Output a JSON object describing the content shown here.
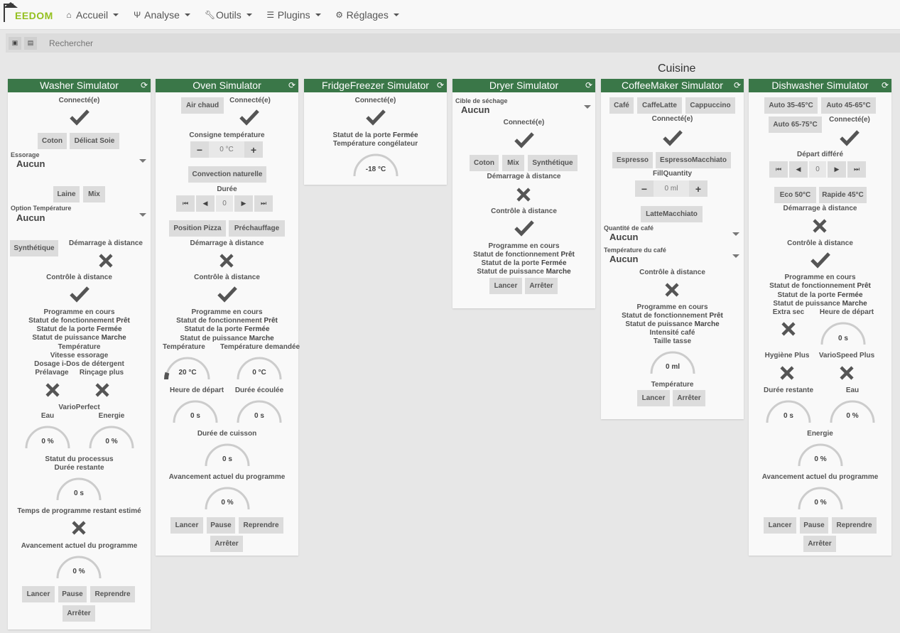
{
  "app": {
    "logo_text": "EEDOM"
  },
  "nav": {
    "accueil": "Accueil",
    "analyse": "Analyse",
    "outils": "Outils",
    "plugins": "Plugins",
    "reglages": "Réglages"
  },
  "search": {
    "placeholder": "Rechercher"
  },
  "room": {
    "title": "Cuisine"
  },
  "icons": {
    "check": "check-icon",
    "cross": "cross-icon",
    "refresh": "refresh-icon"
  },
  "colors": {
    "header": "#3a7748",
    "button": "#dcdcdc",
    "logo": "#94c01f"
  },
  "washer": {
    "title": "Washer Simulator",
    "connected": "Connecté(e)",
    "btn_coton": "Coton",
    "btn_delicat": "Délicat Soie",
    "essorage_label": "Essorage",
    "essorage_value": "Aucun",
    "btn_laine": "Laine",
    "btn_mix": "Mix",
    "option_temp_label": "Option Température",
    "option_temp_value": "Aucun",
    "btn_synthetique": "Synthétique",
    "demarrage": "Démarrage à distance",
    "controle": "Contrôle à distance",
    "programme": "Programme en cours",
    "statut_fonct_label": "Statut de fonctionnement",
    "statut_fonct_value": "Prêt",
    "statut_porte_label": "Statut de la porte",
    "statut_porte_value": "Fermée",
    "statut_puis_label": "Statut de puissance",
    "statut_puis_value": "Marche",
    "temperature": "Température",
    "vitesse": "Vitesse essorage",
    "dosage": "Dosage i-Dos de détergent",
    "prelavage": "Prélavage",
    "rincage": "Rinçage plus",
    "vario": "VarioPerfect",
    "eau": "Eau",
    "eau_val": "0 %",
    "energie": "Energie",
    "energie_val": "0 %",
    "statut_proc": "Statut du processus",
    "duree_restante": "Durée restante",
    "duree_restante_val": "0 s",
    "temps_estime": "Temps de programme restant estimé",
    "avancement": "Avancement actuel du programme",
    "avancement_val": "0 %",
    "btn_lancer": "Lancer",
    "btn_pause": "Pause",
    "btn_reprendre": "Reprendre",
    "btn_arreter": "Arrêter"
  },
  "oven": {
    "title": "Oven Simulator",
    "btn_air": "Air chaud",
    "connected": "Connecté(e)",
    "consigne": "Consigne température",
    "consigne_val": "0 °C",
    "btn_convection": "Convection naturelle",
    "duree": "Durée",
    "duree_val": "0",
    "btn_pizza": "Position Pizza",
    "btn_prechauffage": "Préchauffage",
    "demarrage": "Démarrage à distance",
    "controle": "Contrôle à distance",
    "programme": "Programme en cours",
    "statut_fonct_label": "Statut de fonctionnement",
    "statut_fonct_value": "Prêt",
    "statut_porte_label": "Statut de la porte",
    "statut_porte_value": "Fermée",
    "statut_puis_label": "Statut de puissance",
    "statut_puis_value": "Marche",
    "temperature": "Température",
    "temperature_val": "20 °C",
    "temperature_level": 0.1,
    "temp_demandee": "Température demandée",
    "temp_demandee_val": "0 °C",
    "heure_depart": "Heure de départ",
    "heure_depart_val": "0 s",
    "duree_ecoulee": "Durée écoulée",
    "duree_ecoulee_val": "0 s",
    "duree_cuisson": "Durée de cuisson",
    "duree_cuisson_val": "0 s",
    "avancement": "Avancement actuel du programme",
    "avancement_val": "0 %",
    "btn_lancer": "Lancer",
    "btn_pause": "Pause",
    "btn_reprendre": "Reprendre",
    "btn_arreter": "Arrêter"
  },
  "fridge": {
    "title": "FridgeFreezer Simulator",
    "connected": "Connecté(e)",
    "statut_porte_label": "Statut de la porte",
    "statut_porte_value": "Fermée",
    "temp_cong": "Température congélateur",
    "temp_cong_val": "-18 °C"
  },
  "dryer": {
    "title": "Dryer Simulator",
    "cible_label": "Cible de séchage",
    "cible_value": "Aucun",
    "connected": "Connecté(e)",
    "btn_coton": "Coton",
    "btn_mix": "Mix",
    "btn_synthetique": "Synthétique",
    "demarrage": "Démarrage à distance",
    "controle": "Contrôle à distance",
    "programme": "Programme en cours",
    "statut_fonct_label": "Statut de fonctionnement",
    "statut_fonct_value": "Prêt",
    "statut_porte_label": "Statut de la porte",
    "statut_porte_value": "Fermée",
    "statut_puis_label": "Statut de puissance",
    "statut_puis_value": "Marche",
    "btn_lancer": "Lancer",
    "btn_arreter": "Arrêter"
  },
  "coffee": {
    "title": "CoffeeMaker Simulator",
    "btn_cafe": "Café",
    "btn_caffelatte": "CaffeLatte",
    "btn_cappuccino": "Cappuccino",
    "connected": "Connecté(e)",
    "btn_espresso": "Espresso",
    "btn_espressomacchiato": "EspressoMacchiato",
    "fillquantity": "FillQuantity",
    "fillquantity_val": "0 ml",
    "btn_lattemacchiato": "LatteMacchiato",
    "quantite_label": "Quantité de café",
    "quantite_value": "Aucun",
    "temp_cafe_label": "Température du café",
    "temp_cafe_value": "Aucun",
    "controle": "Contrôle à distance",
    "programme": "Programme en cours",
    "statut_fonct_label": "Statut de fonctionnement",
    "statut_fonct_value": "Prêt",
    "statut_puis_label": "Statut de puissance",
    "statut_puis_value": "Marche",
    "intensite": "Intensité café",
    "taille": "Taille tasse",
    "taille_val": "0 ml",
    "temperature": "Température",
    "btn_lancer": "Lancer",
    "btn_arreter": "Arrêter"
  },
  "dish": {
    "title": "Dishwasher Simulator",
    "btn_auto35": "Auto 35-45°C",
    "btn_auto45": "Auto 45-65°C",
    "btn_auto65": "Auto 65-75°C",
    "connected": "Connecté(e)",
    "depart_differe": "Départ différé",
    "depart_val": "0",
    "btn_eco": "Eco 50°C",
    "btn_rapide": "Rapide 45°C",
    "demarrage": "Démarrage à distance",
    "controle": "Contrôle à distance",
    "programme": "Programme en cours",
    "statut_fonct_label": "Statut de fonctionnement",
    "statut_fonct_value": "Prêt",
    "statut_porte_label": "Statut de la porte",
    "statut_porte_value": "Fermée",
    "statut_puis_label": "Statut de puissance",
    "statut_puis_value": "Marche",
    "extra_sec": "Extra sec",
    "heure_depart": "Heure de départ",
    "heure_depart_val": "0 s",
    "hygiene": "Hygiène Plus",
    "variospeed": "VarioSpeed Plus",
    "duree_restante": "Durée restante",
    "duree_restante_val": "0 s",
    "eau": "Eau",
    "eau_val": "0 %",
    "energie": "Energie",
    "energie_val": "0 %",
    "avancement": "Avancement actuel du programme",
    "avancement_val": "0 %",
    "btn_lancer": "Lancer",
    "btn_pause": "Pause",
    "btn_reprendre": "Reprendre",
    "btn_arreter": "Arrêter"
  }
}
